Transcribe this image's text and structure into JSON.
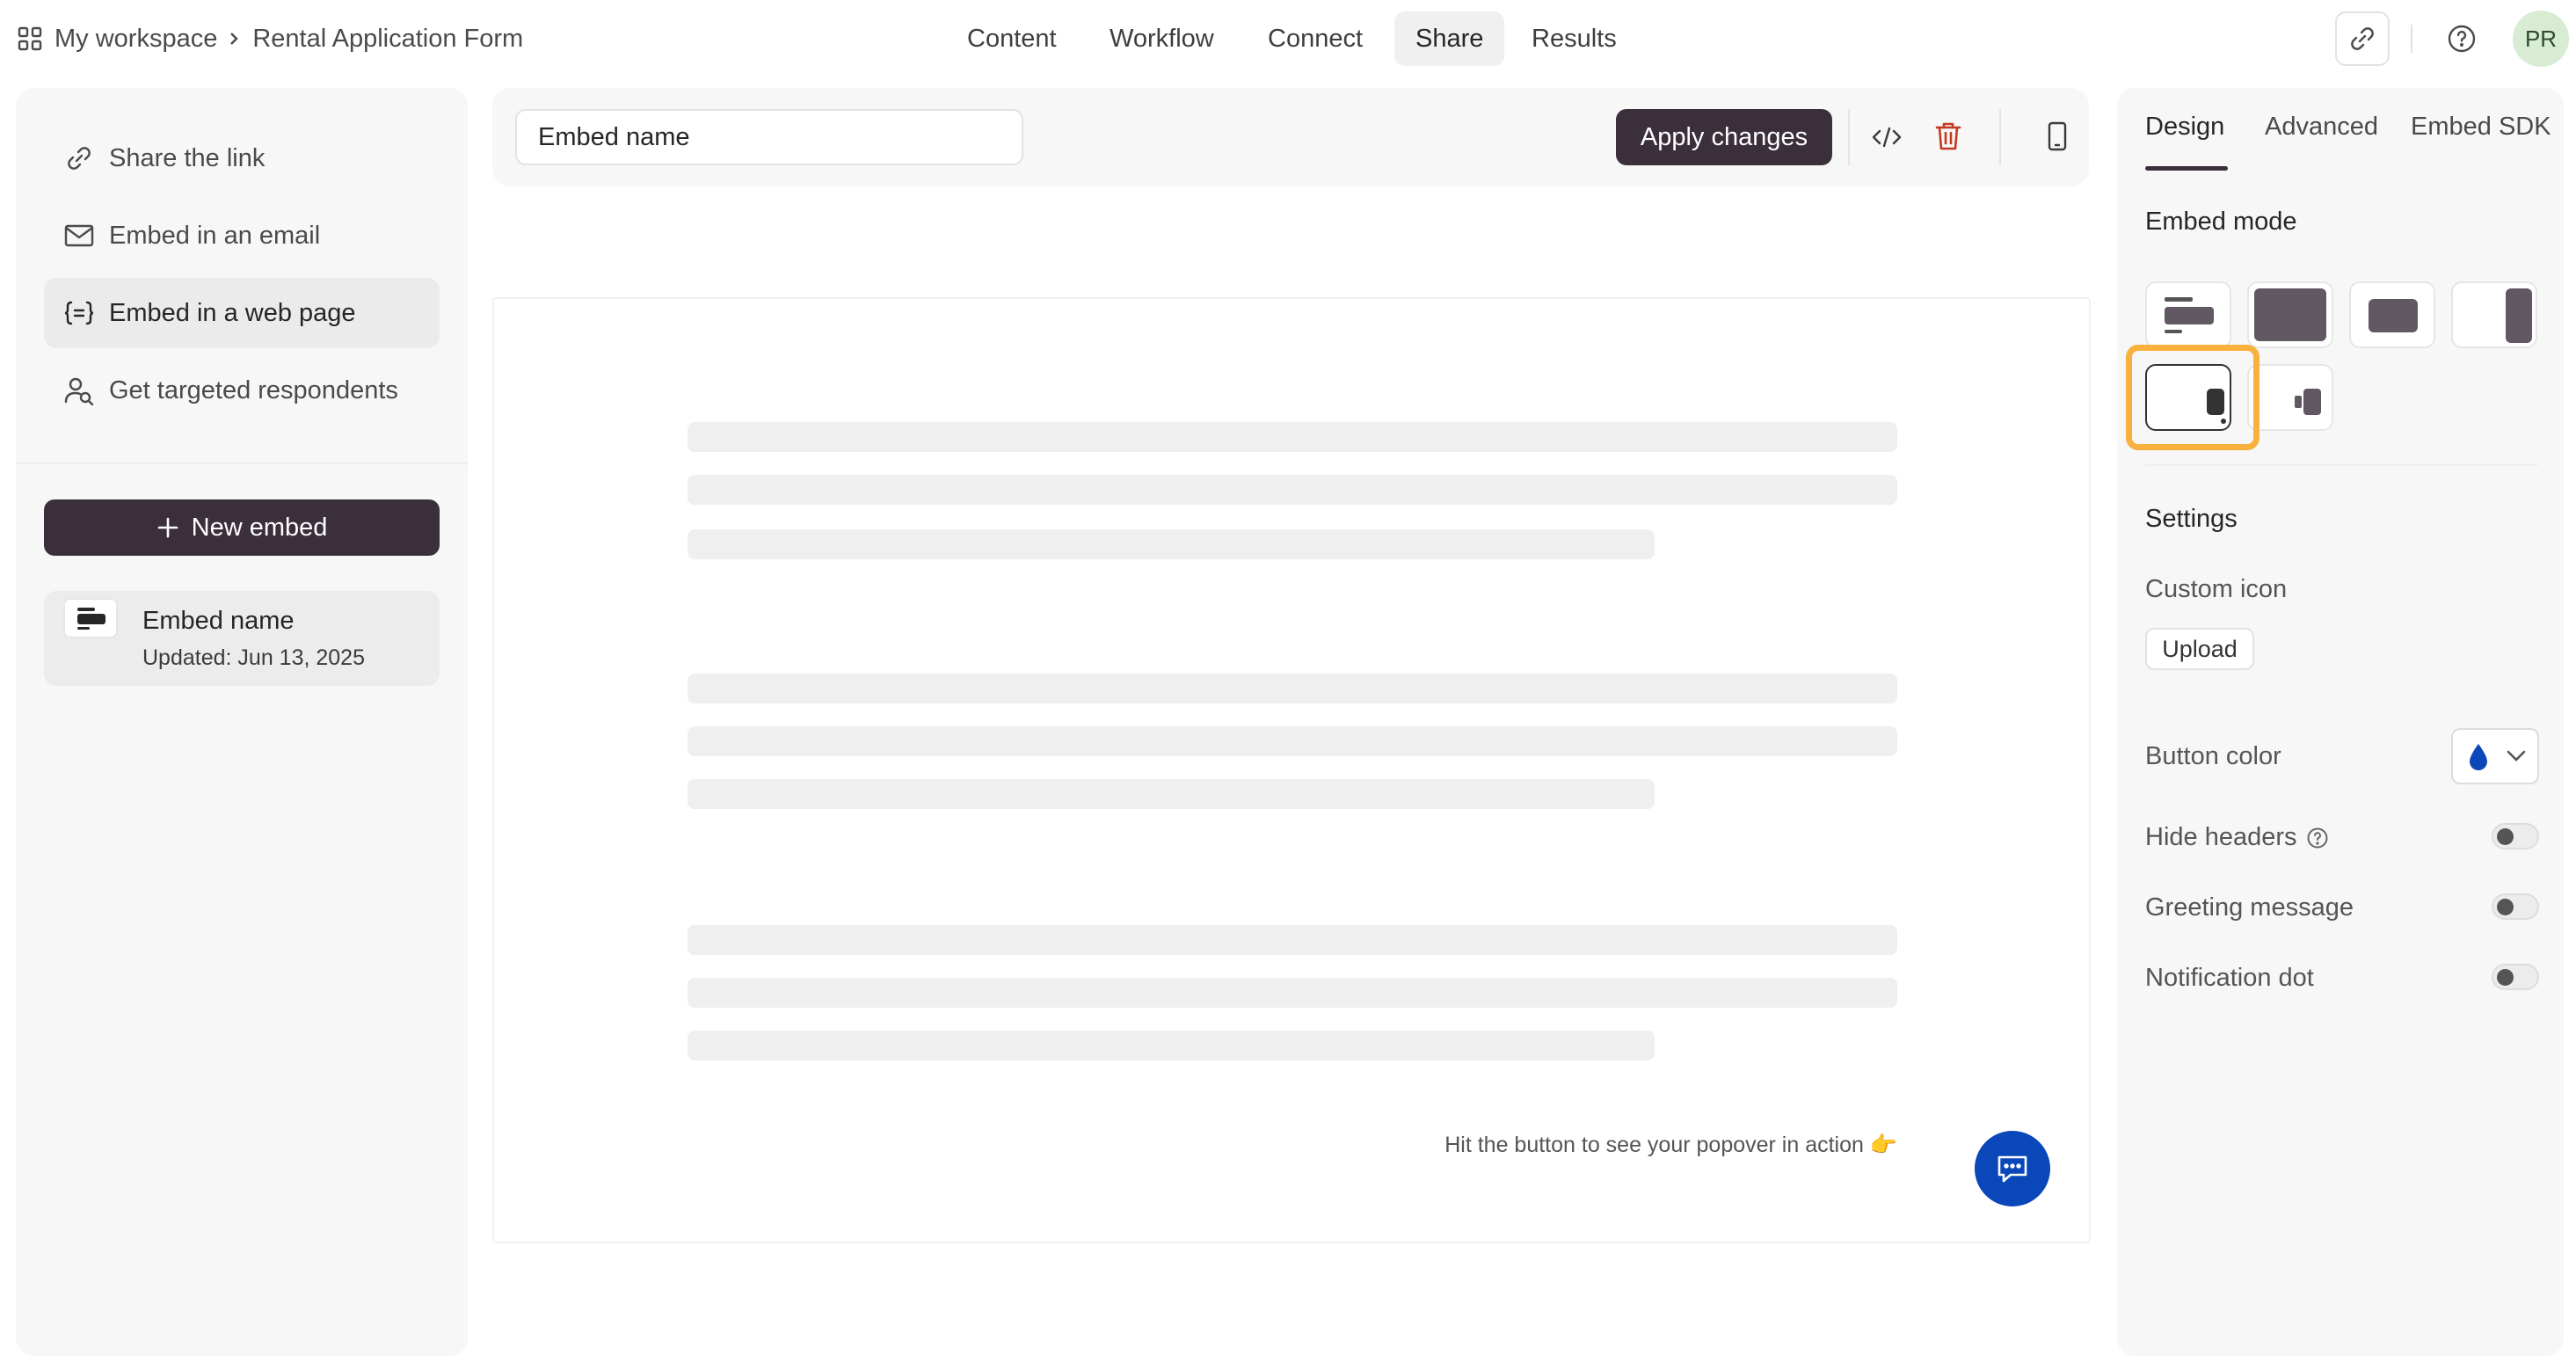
{
  "topbar": {
    "workspace": "My workspace",
    "separator": ">",
    "form_title": "Rental Application Form",
    "tabs": [
      {
        "label": "Content"
      },
      {
        "label": "Workflow"
      },
      {
        "label": "Connect"
      },
      {
        "label": "Share"
      },
      {
        "label": "Results"
      }
    ],
    "active_tab": "Share",
    "avatar_initials": "PR",
    "icons": [
      "grid-icon",
      "link-icon",
      "help-icon"
    ]
  },
  "sidebar": {
    "items": [
      {
        "label": "Share the link",
        "icon": "link-icon"
      },
      {
        "label": "Embed in an email",
        "icon": "envelope-icon"
      },
      {
        "label": "Embed in a web page",
        "icon": "embed-code-icon"
      },
      {
        "label": "Get targeted respondents",
        "icon": "person-search-icon"
      }
    ],
    "active_item": "Embed in a web page",
    "new_embed_label": "New embed",
    "embeds": [
      {
        "name": "Embed name",
        "updated": "Updated: Jun 13, 2025"
      }
    ]
  },
  "toolbar": {
    "embed_name_value": "Embed name",
    "apply_label": "Apply changes"
  },
  "preview": {
    "hint": "Hit the button to see your popover in action 👉"
  },
  "panel": {
    "tabs": [
      {
        "label": "Design"
      },
      {
        "label": "Advanced"
      },
      {
        "label": "Embed SDK"
      }
    ],
    "active_tab": "Design",
    "embed_mode_title": "Embed mode",
    "embed_modes": [
      "standard",
      "full-page",
      "popup",
      "slider",
      "popover",
      "side-tab"
    ],
    "selected_mode": "popover",
    "settings_title": "Settings",
    "custom_icon_label": "Custom icon",
    "upload_label": "Upload",
    "button_color_label": "Button color",
    "button_color": "#0a47b8",
    "hide_headers_label": "Hide headers",
    "greeting_label": "Greeting message",
    "notification_label": "Notification dot"
  },
  "colors": {
    "primary_dark": "#3a2f3b",
    "accent_blue": "#0a47b8",
    "highlight": "#f8b13c",
    "delete_red": "#c53a1f",
    "avatar_bg": "#d7ecd3"
  }
}
